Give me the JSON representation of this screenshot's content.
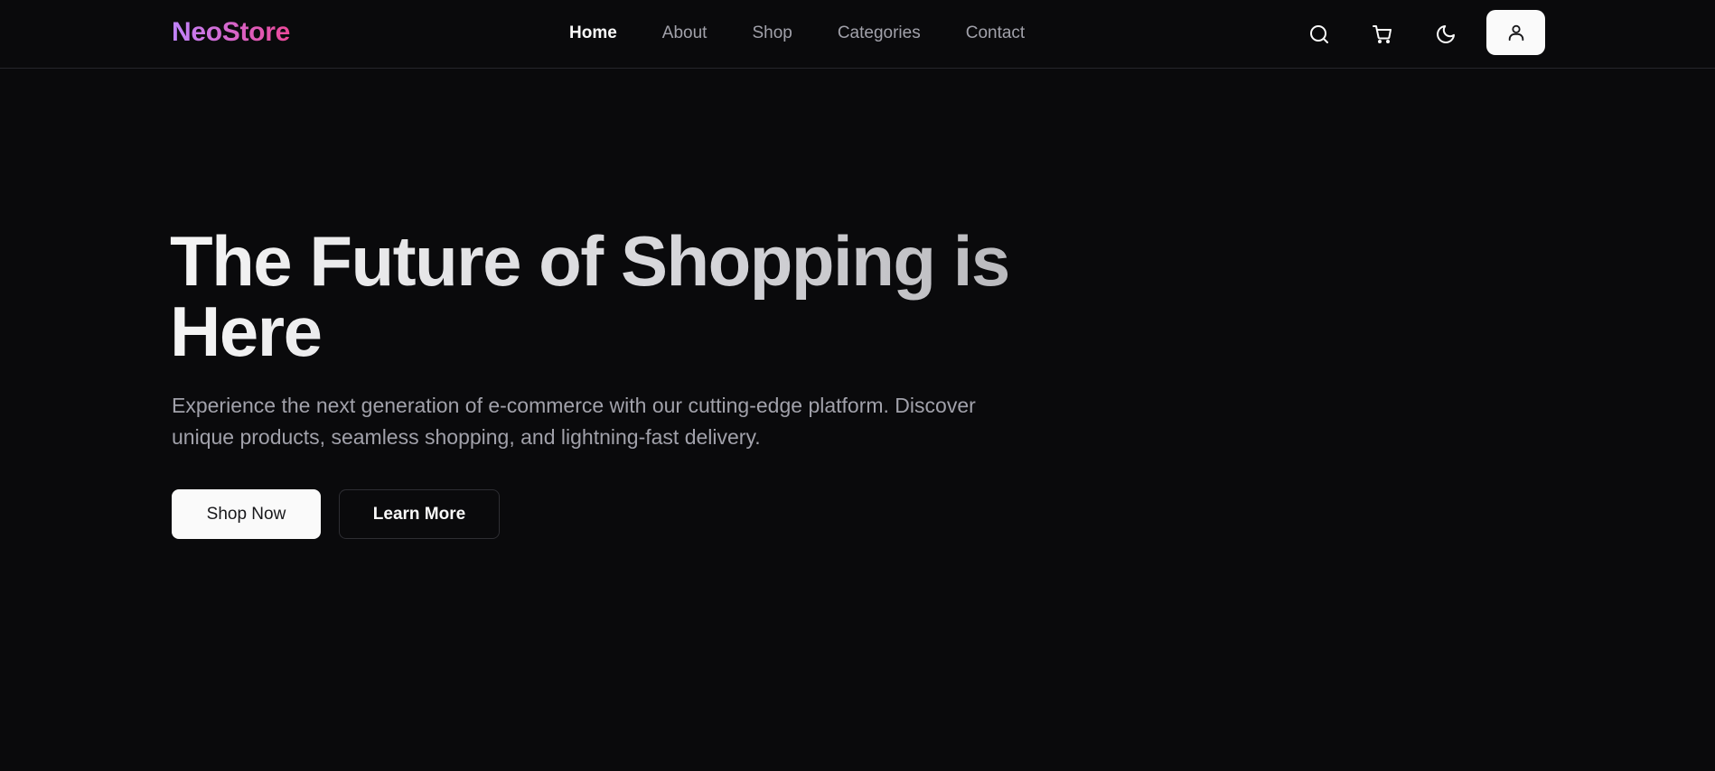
{
  "header": {
    "logo": "NeoStore",
    "nav": [
      {
        "label": "Home",
        "active": true
      },
      {
        "label": "About",
        "active": false
      },
      {
        "label": "Shop",
        "active": false
      },
      {
        "label": "Categories",
        "active": false
      },
      {
        "label": "Contact",
        "active": false
      }
    ],
    "icons": [
      "search-icon",
      "cart-icon",
      "moon-icon",
      "user-icon"
    ]
  },
  "hero": {
    "title": "The Future of Shopping is Here",
    "subtitle": "Experience the next generation of e-commerce with our cutting-edge platform. Discover unique products, seamless shopping, and lightning-fast delivery.",
    "primary_button": "Shop Now",
    "secondary_button": "Learn More"
  },
  "colors": {
    "background": "#0a0a0c",
    "logo_gradient_start": "#c084fc",
    "logo_gradient_end": "#ec4899",
    "nav_inactive": "#a1a1aa",
    "nav_active": "#fafafa"
  }
}
